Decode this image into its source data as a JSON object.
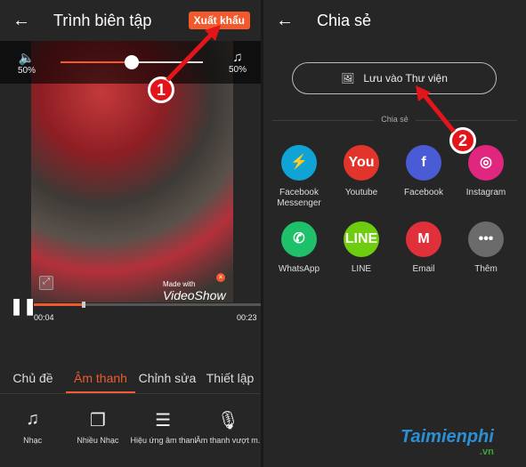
{
  "editor": {
    "back": "←",
    "title": "Trình biên tập",
    "export_label": "Xuất khẩu",
    "volume_left": "50%",
    "volume_right": "50%",
    "volume_fraction": 0.5,
    "watermark_small": "Made with",
    "watermark_brand": "VideoShow",
    "time_current": "00:04",
    "time_total": "00:23",
    "progress_fraction": 0.21,
    "tabs": [
      {
        "label": "Chủ đề"
      },
      {
        "label": "Âm thanh",
        "active": true
      },
      {
        "label": "Chỉnh sửa"
      },
      {
        "label": "Thiết lập"
      }
    ],
    "tools": [
      {
        "label": "Nhạc",
        "icon": "♫"
      },
      {
        "label": "Nhiều Nhạc",
        "icon": "❐"
      },
      {
        "label": "Hiệu ứng âm thanh",
        "icon": "☰"
      },
      {
        "label": "Âm thanh vượt m...",
        "icon": "🎙"
      }
    ]
  },
  "share": {
    "back": "←",
    "title": "Chia sẻ",
    "save_label": "Lưu vào Thư viện",
    "section_label": "Chia sẻ",
    "apps": [
      {
        "label": "Facebook Messenger",
        "glyph": "⚡",
        "color": "#10a3d6"
      },
      {
        "label": "Youtube",
        "glyph": "You",
        "color": "#e1352c"
      },
      {
        "label": "Facebook",
        "glyph": "f",
        "color": "#4a5bd6"
      },
      {
        "label": "Instagram",
        "glyph": "◎",
        "color": "#e0267f"
      },
      {
        "label": "WhatsApp",
        "glyph": "✆",
        "color": "#1fc06a"
      },
      {
        "label": "LINE",
        "glyph": "LINE",
        "color": "#6fcd0f"
      },
      {
        "label": "Email",
        "glyph": "M",
        "color": "#e0303a"
      },
      {
        "label": "Thêm",
        "glyph": "•••",
        "color": "#6b6b6b"
      }
    ]
  },
  "annotations": {
    "step1": "1",
    "step2": "2"
  },
  "logo": {
    "text": "Taimienphi",
    "suffix": ".vn"
  },
  "accent": "#f05a2c"
}
